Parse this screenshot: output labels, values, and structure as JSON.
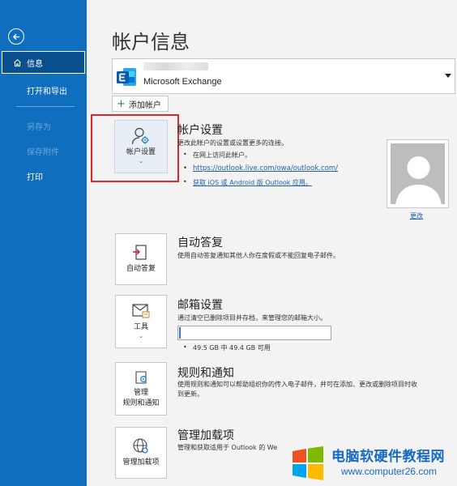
{
  "sidebar": {
    "back_icon": "back-arrow-icon",
    "info_label": "信息",
    "items": [
      {
        "label": "打开和导出",
        "enabled": true
      },
      {
        "label": "另存为",
        "enabled": false
      },
      {
        "label": "保存附件",
        "enabled": false
      },
      {
        "label": "打印",
        "enabled": true
      }
    ]
  },
  "main": {
    "title": "帐户信息",
    "account": {
      "type": "Microsoft Exchange"
    },
    "add_account_label": "添加帐户",
    "sections": {
      "account_settings": {
        "tile_label": "帐户设置",
        "title": "帐户设置",
        "desc": "更改此帐户的设置或设置更多的连接。",
        "bullets": [
          "在网上访问此帐户。",
          "https://outlook.live.com/owa/outlook.com/",
          "获取 iOS 或 Android 版 Outlook 应用。"
        ],
        "change_label": "更改"
      },
      "auto_reply": {
        "tile_label": "自动答复",
        "title": "自动答复",
        "desc": "使用自动答复通知其他人你在度假或不能回复电子邮件。"
      },
      "mailbox": {
        "tile_label": "工具",
        "title": "邮箱设置",
        "desc": "通过清空已删除项目并存档，来管理您的邮箱大小。",
        "usage_fraction": 0.01,
        "usage_text": "49.5 GB 中 49.4 GB 可用"
      },
      "rules": {
        "tile_line1": "管理",
        "tile_line2": "规则和通知",
        "title": "规则和通知",
        "desc_line1": "使用规则和通知可以帮助组织你的传入电子邮件，并可在添加、更改或删除项目时收",
        "desc_line2": "到更新。"
      },
      "addins": {
        "tile_label": "管理加载项",
        "title": "管理加载项",
        "desc": "管理和获取适用于 Outlook 的 We"
      }
    }
  },
  "watermark": {
    "title": "电脑软硬件教程网",
    "url": "www.computer26.com"
  },
  "colors": {
    "sidebar": "#106ebe",
    "accent": "#1a5fb4",
    "highlight": "#e0262b"
  }
}
